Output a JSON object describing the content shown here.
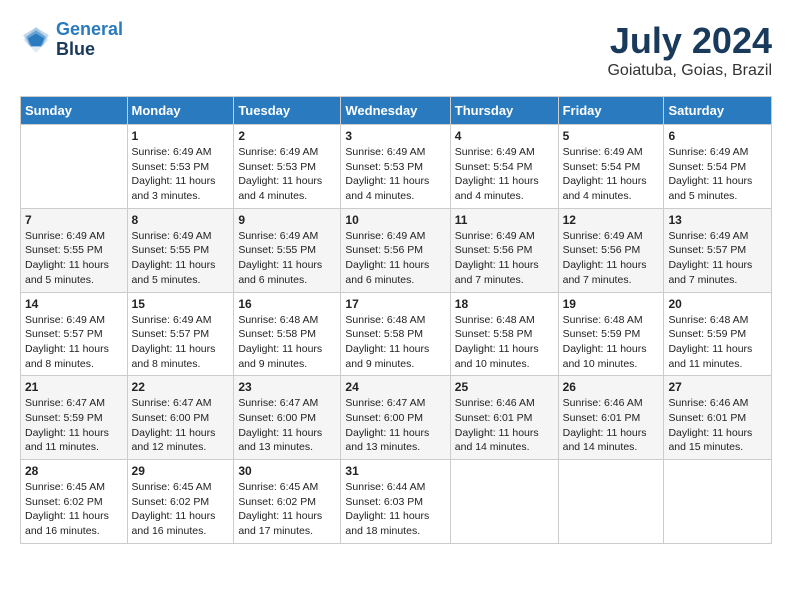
{
  "header": {
    "logo_line1": "General",
    "logo_line2": "Blue",
    "title": "July 2024",
    "subtitle": "Goiatuba, Goias, Brazil"
  },
  "days_of_week": [
    "Sunday",
    "Monday",
    "Tuesday",
    "Wednesday",
    "Thursday",
    "Friday",
    "Saturday"
  ],
  "weeks": [
    [
      {
        "day": "",
        "info": ""
      },
      {
        "day": "1",
        "info": "Sunrise: 6:49 AM\nSunset: 5:53 PM\nDaylight: 11 hours\nand 3 minutes."
      },
      {
        "day": "2",
        "info": "Sunrise: 6:49 AM\nSunset: 5:53 PM\nDaylight: 11 hours\nand 4 minutes."
      },
      {
        "day": "3",
        "info": "Sunrise: 6:49 AM\nSunset: 5:53 PM\nDaylight: 11 hours\nand 4 minutes."
      },
      {
        "day": "4",
        "info": "Sunrise: 6:49 AM\nSunset: 5:54 PM\nDaylight: 11 hours\nand 4 minutes."
      },
      {
        "day": "5",
        "info": "Sunrise: 6:49 AM\nSunset: 5:54 PM\nDaylight: 11 hours\nand 4 minutes."
      },
      {
        "day": "6",
        "info": "Sunrise: 6:49 AM\nSunset: 5:54 PM\nDaylight: 11 hours\nand 5 minutes."
      }
    ],
    [
      {
        "day": "7",
        "info": "Sunrise: 6:49 AM\nSunset: 5:55 PM\nDaylight: 11 hours\nand 5 minutes."
      },
      {
        "day": "8",
        "info": "Sunrise: 6:49 AM\nSunset: 5:55 PM\nDaylight: 11 hours\nand 5 minutes."
      },
      {
        "day": "9",
        "info": "Sunrise: 6:49 AM\nSunset: 5:55 PM\nDaylight: 11 hours\nand 6 minutes."
      },
      {
        "day": "10",
        "info": "Sunrise: 6:49 AM\nSunset: 5:56 PM\nDaylight: 11 hours\nand 6 minutes."
      },
      {
        "day": "11",
        "info": "Sunrise: 6:49 AM\nSunset: 5:56 PM\nDaylight: 11 hours\nand 7 minutes."
      },
      {
        "day": "12",
        "info": "Sunrise: 6:49 AM\nSunset: 5:56 PM\nDaylight: 11 hours\nand 7 minutes."
      },
      {
        "day": "13",
        "info": "Sunrise: 6:49 AM\nSunset: 5:57 PM\nDaylight: 11 hours\nand 7 minutes."
      }
    ],
    [
      {
        "day": "14",
        "info": "Sunrise: 6:49 AM\nSunset: 5:57 PM\nDaylight: 11 hours\nand 8 minutes."
      },
      {
        "day": "15",
        "info": "Sunrise: 6:49 AM\nSunset: 5:57 PM\nDaylight: 11 hours\nand 8 minutes."
      },
      {
        "day": "16",
        "info": "Sunrise: 6:48 AM\nSunset: 5:58 PM\nDaylight: 11 hours\nand 9 minutes."
      },
      {
        "day": "17",
        "info": "Sunrise: 6:48 AM\nSunset: 5:58 PM\nDaylight: 11 hours\nand 9 minutes."
      },
      {
        "day": "18",
        "info": "Sunrise: 6:48 AM\nSunset: 5:58 PM\nDaylight: 11 hours\nand 10 minutes."
      },
      {
        "day": "19",
        "info": "Sunrise: 6:48 AM\nSunset: 5:59 PM\nDaylight: 11 hours\nand 10 minutes."
      },
      {
        "day": "20",
        "info": "Sunrise: 6:48 AM\nSunset: 5:59 PM\nDaylight: 11 hours\nand 11 minutes."
      }
    ],
    [
      {
        "day": "21",
        "info": "Sunrise: 6:47 AM\nSunset: 5:59 PM\nDaylight: 11 hours\nand 11 minutes."
      },
      {
        "day": "22",
        "info": "Sunrise: 6:47 AM\nSunset: 6:00 PM\nDaylight: 11 hours\nand 12 minutes."
      },
      {
        "day": "23",
        "info": "Sunrise: 6:47 AM\nSunset: 6:00 PM\nDaylight: 11 hours\nand 13 minutes."
      },
      {
        "day": "24",
        "info": "Sunrise: 6:47 AM\nSunset: 6:00 PM\nDaylight: 11 hours\nand 13 minutes."
      },
      {
        "day": "25",
        "info": "Sunrise: 6:46 AM\nSunset: 6:01 PM\nDaylight: 11 hours\nand 14 minutes."
      },
      {
        "day": "26",
        "info": "Sunrise: 6:46 AM\nSunset: 6:01 PM\nDaylight: 11 hours\nand 14 minutes."
      },
      {
        "day": "27",
        "info": "Sunrise: 6:46 AM\nSunset: 6:01 PM\nDaylight: 11 hours\nand 15 minutes."
      }
    ],
    [
      {
        "day": "28",
        "info": "Sunrise: 6:45 AM\nSunset: 6:02 PM\nDaylight: 11 hours\nand 16 minutes."
      },
      {
        "day": "29",
        "info": "Sunrise: 6:45 AM\nSunset: 6:02 PM\nDaylight: 11 hours\nand 16 minutes."
      },
      {
        "day": "30",
        "info": "Sunrise: 6:45 AM\nSunset: 6:02 PM\nDaylight: 11 hours\nand 17 minutes."
      },
      {
        "day": "31",
        "info": "Sunrise: 6:44 AM\nSunset: 6:03 PM\nDaylight: 11 hours\nand 18 minutes."
      },
      {
        "day": "",
        "info": ""
      },
      {
        "day": "",
        "info": ""
      },
      {
        "day": "",
        "info": ""
      }
    ]
  ]
}
